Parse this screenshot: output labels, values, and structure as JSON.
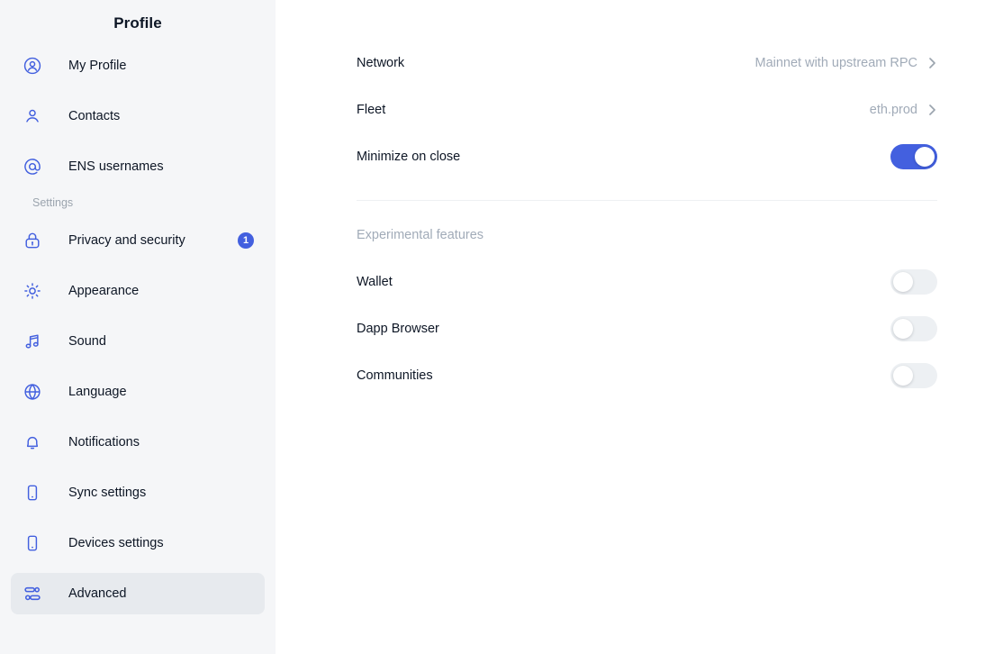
{
  "sidebar": {
    "title": "Profile",
    "items": [
      {
        "label": "My Profile",
        "icon": "user-circle-icon",
        "badge": null,
        "active": false,
        "section": null
      },
      {
        "label": "Contacts",
        "icon": "user-icon",
        "badge": null,
        "active": false,
        "section": null
      },
      {
        "label": "ENS usernames",
        "icon": "at-sign-icon",
        "badge": null,
        "active": false,
        "section": null
      },
      {
        "label": "Privacy and security",
        "icon": "lock-icon",
        "badge": "1",
        "active": false,
        "section": "Settings"
      },
      {
        "label": "Appearance",
        "icon": "sun-icon",
        "badge": null,
        "active": false,
        "section": null
      },
      {
        "label": "Sound",
        "icon": "music-note-icon",
        "badge": null,
        "active": false,
        "section": null
      },
      {
        "label": "Language",
        "icon": "globe-icon",
        "badge": null,
        "active": false,
        "section": null
      },
      {
        "label": "Notifications",
        "icon": "bell-icon",
        "badge": null,
        "active": false,
        "section": null
      },
      {
        "label": "Sync settings",
        "icon": "mobile-icon",
        "badge": null,
        "active": false,
        "section": null
      },
      {
        "label": "Devices settings",
        "icon": "mobile-icon",
        "badge": null,
        "active": false,
        "section": null
      },
      {
        "label": "Advanced",
        "icon": "sliders-icon",
        "badge": null,
        "active": true,
        "section": null
      }
    ],
    "section_label": "Settings"
  },
  "main": {
    "rows": [
      {
        "label": "Network",
        "value": "Mainnet with upstream RPC",
        "type": "link",
        "state": null
      },
      {
        "label": "Fleet",
        "value": "eth.prod",
        "type": "link",
        "state": null
      },
      {
        "label": "Minimize on close",
        "value": null,
        "type": "toggle",
        "state": "on"
      }
    ],
    "experimental": {
      "heading": "Experimental features",
      "rows": [
        {
          "label": "Wallet",
          "value": null,
          "type": "toggle",
          "state": "off"
        },
        {
          "label": "Dapp Browser",
          "value": null,
          "type": "toggle",
          "state": "off"
        },
        {
          "label": "Communities",
          "value": null,
          "type": "toggle",
          "state": "off"
        }
      ]
    }
  },
  "colors": {
    "accent": "#4360DF",
    "sidebar_bg": "#F5F6F8",
    "active_row_bg": "#E7EAEE",
    "text_primary": "#0D1625",
    "text_muted": "#A1ABB8",
    "toggle_off": "#EDF0F3"
  }
}
